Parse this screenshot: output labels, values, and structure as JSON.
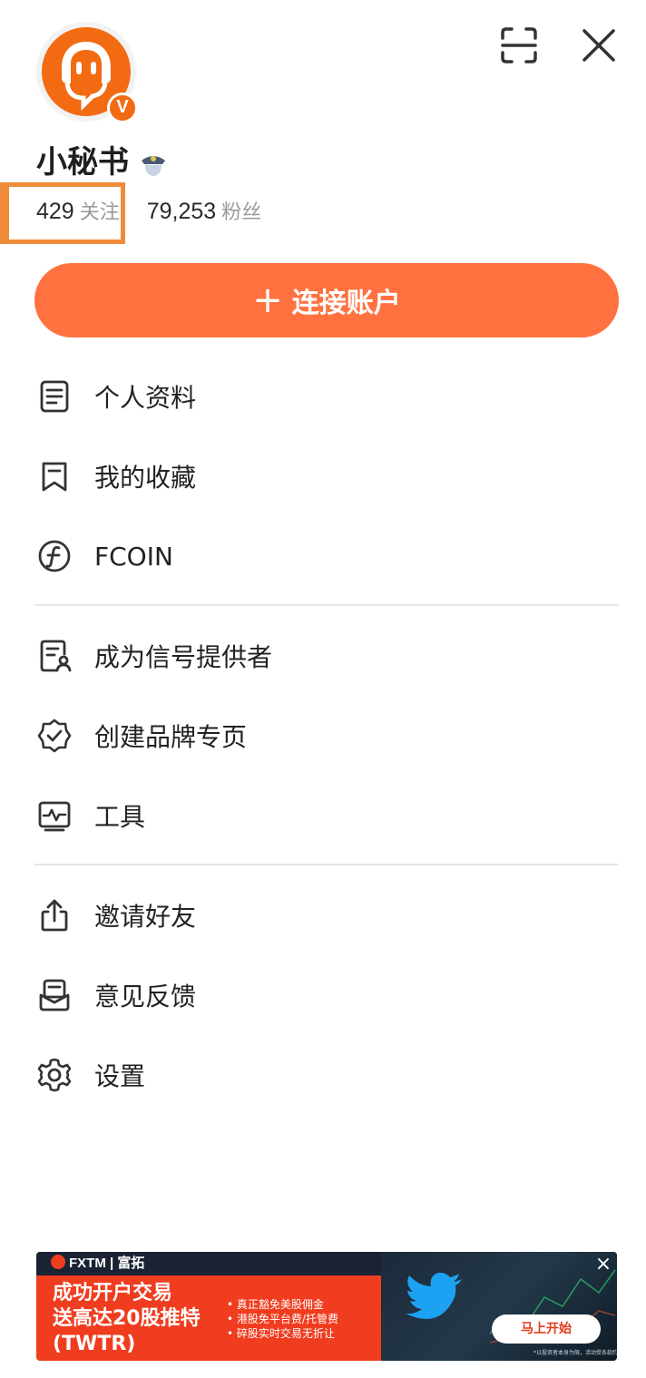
{
  "colors": {
    "accent": "#ff7240",
    "brand_orange": "#f26a12",
    "highlight": "#f08b3a",
    "text": "#222222",
    "muted": "#9a9a9a"
  },
  "header": {
    "avatar_icon": "headset-chat-icon",
    "verified_badge": "V",
    "username": "小秘书",
    "police_badge_icon": "police-badge-icon"
  },
  "stats": {
    "following_count": "429",
    "following_label": "关注",
    "followers_count": "79,253",
    "followers_label": "粉丝"
  },
  "connect_button": {
    "plus": "+",
    "label": "连接账户"
  },
  "menu_groups": [
    [
      {
        "icon": "document-icon",
        "label": "个人资料"
      },
      {
        "icon": "bookmark-icon",
        "label": "我的收藏"
      },
      {
        "icon": "fcoin-icon",
        "label": "FCOIN"
      }
    ],
    [
      {
        "icon": "signal-provider-icon",
        "label": "成为信号提供者"
      },
      {
        "icon": "verified-shield-icon",
        "label": "创建品牌专页"
      },
      {
        "icon": "tools-monitor-icon",
        "label": "工具"
      }
    ],
    [
      {
        "icon": "share-icon",
        "label": "邀请好友"
      },
      {
        "icon": "feedback-icon",
        "label": "意见反馈"
      },
      {
        "icon": "gear-icon",
        "label": "设置"
      }
    ]
  ],
  "ad": {
    "brand": "FXTM | 富拓",
    "headline_line1": "成功开户交易",
    "headline_line2": "送高达20股推特",
    "headline_line3": "(TWTR)",
    "bullets": [
      "真正豁免美股佣金",
      "港股免平台费/托管费",
      "碎股实时交易无折让"
    ],
    "cta": "马上开始",
    "footnote": "*以投资者本身为限，活动受条款约束"
  }
}
